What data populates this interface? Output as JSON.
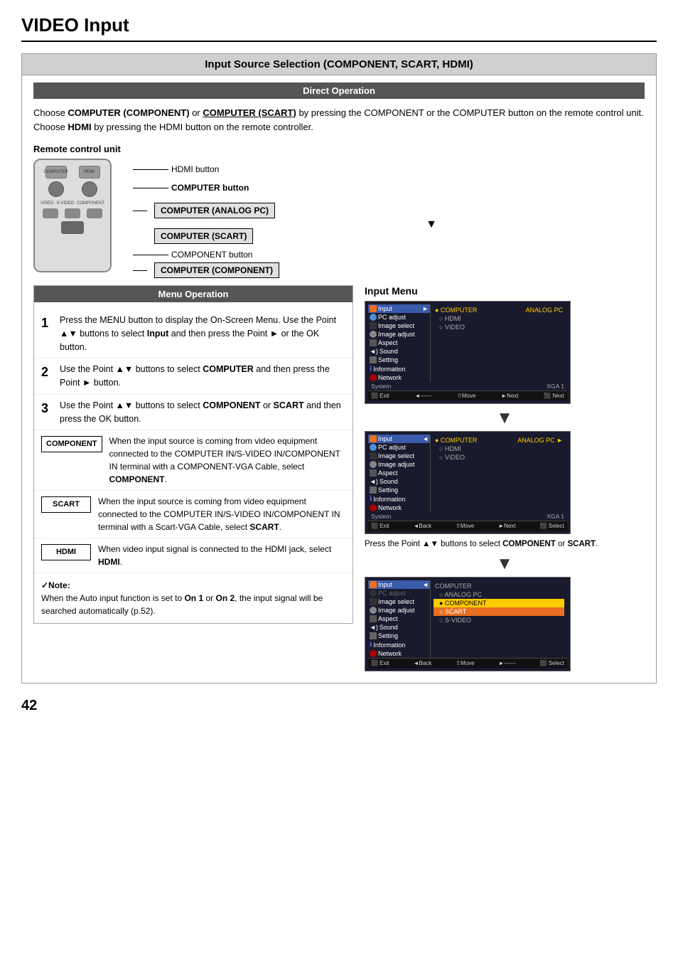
{
  "page": {
    "title": "VIDEO Input",
    "number": "42",
    "section_title": "Input Source Selection (COMPONENT, SCART, HDMI)"
  },
  "direct_operation": {
    "header": "Direct Operation",
    "intro": "Choose COMPUTER (COMPONENT) or COMPUTER (SCART) by pressing the COMPONENT or the COMPUTER button on the remote control unit. Choose HDMI by pressing the HDMI button on the remote controller."
  },
  "remote": {
    "label": "Remote control unit",
    "hdmi_button": "HDMI button",
    "computer_button": "COMPUTER button",
    "component_button": "COMPONENT button",
    "callout_boxes": [
      "COMPUTER (ANALOG PC)",
      "COMPUTER (SCART)",
      "COMPUTER (COMPONENT)"
    ]
  },
  "menu_operation": {
    "header": "Menu Operation",
    "steps": [
      {
        "num": "1",
        "text": "Press the MENU button to display the On-Screen Menu. Use the Point ▲▼ buttons to select Input and then press the Point ► or the OK button."
      },
      {
        "num": "2",
        "text": "Use the Point ▲▼ buttons to select COMPUTER and then press the Point ► button."
      },
      {
        "num": "3",
        "text": "Use the Point ▲▼ buttons to select COMPONENT or SCART and then press the OK button."
      }
    ],
    "terms": [
      {
        "label": "COMPONENT",
        "text": "When the input source is coming from video equipment connected to the COMPUTER IN/S-VIDEO IN/COMPONENT IN terminal with a COMPONENT-VGA Cable, select COMPONENT."
      },
      {
        "label": "SCART",
        "text": "When the input source is coming from video equipment connected to the COMPUTER IN/S-VIDEO IN/COMPONENT IN terminal with a Scart-VGA Cable, select SCART."
      },
      {
        "label": "HDMI",
        "text": "When video input signal is connected to the HDMI jack, select HDMI."
      }
    ],
    "note_title": "✓Note:",
    "note_text": "When the Auto input function is set to On 1 or On 2, the input signal will be searched automatically (p.52)."
  },
  "input_menu": {
    "title": "Input Menu",
    "menu1": {
      "items_left": [
        "Input",
        "PC adjust",
        "Image select",
        "Image adjust",
        "Aspect",
        "Sound",
        "Setting",
        "Information",
        "Network"
      ],
      "items_right_header": "COMPUTER",
      "items_right": [
        "HDMI",
        "VIDEO"
      ],
      "right_label": "ANALOG PC",
      "system_label": "System",
      "system_value": "XGA 1",
      "bottom_bar": [
        "Exit",
        "◄------",
        "⇧Move",
        "►Next",
        "OK Next"
      ]
    },
    "menu2": {
      "right_label": "ANALOG PC ►",
      "bottom_bar": [
        "Exit",
        "◄Back",
        "⇧Move",
        "►Next",
        "OK Select"
      ]
    },
    "caption2": "Press the Point ▲▼ buttons to select COMPONENT or SCART.",
    "menu3": {
      "items_right": [
        "ANALOG PC",
        "COMPONENT",
        "SCART",
        "S-VIDEO"
      ],
      "bottom_bar": [
        "Exit",
        "◄Back",
        "⇧Move",
        "►------",
        "OK Select"
      ]
    }
  }
}
